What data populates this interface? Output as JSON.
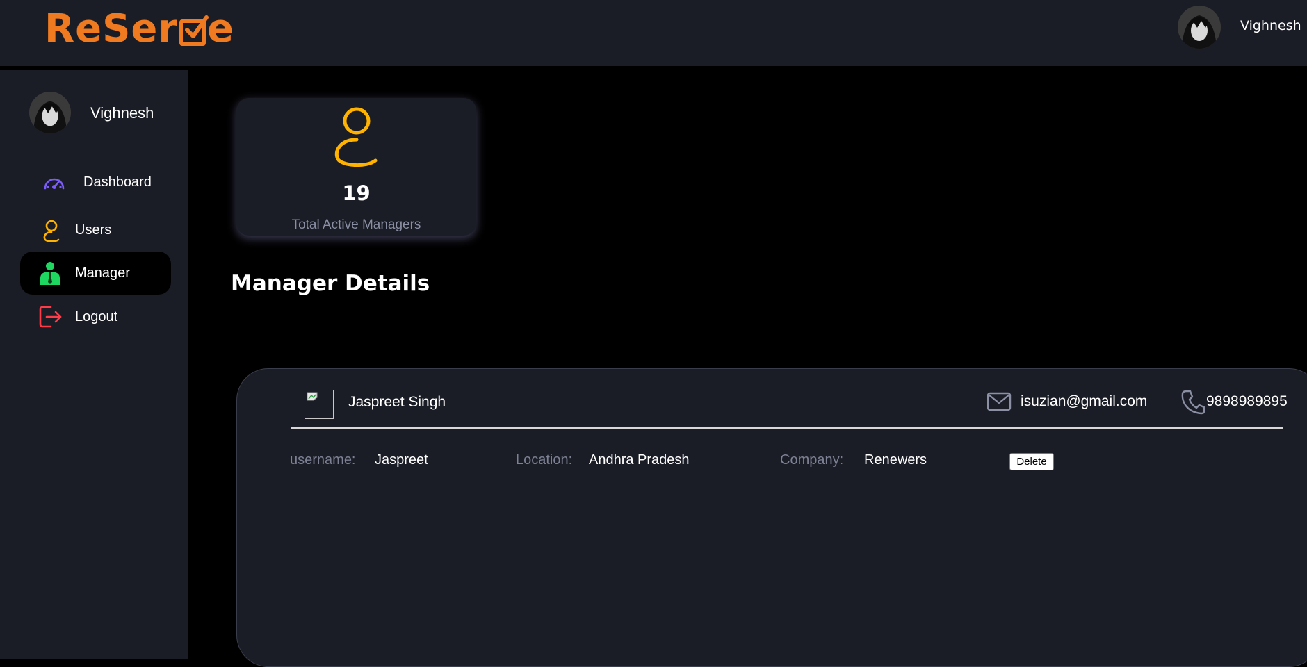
{
  "header": {
    "logo_text_1": "ReSer",
    "logo_text_2": "e",
    "user_name": "Vighnesh",
    "accent": "#f07a1f"
  },
  "sidebar": {
    "user_name": "Vighnesh",
    "items": [
      {
        "label": "Dashboard",
        "icon": "speedometer-icon",
        "color": "#7b5cff",
        "active": false
      },
      {
        "label": "Users",
        "icon": "user-icon",
        "color": "#ffb300",
        "active": false
      },
      {
        "label": "Manager",
        "icon": "manager-icon",
        "color": "#1ed760",
        "active": true
      },
      {
        "label": "Logout",
        "icon": "logout-icon",
        "color": "#ff3b47",
        "active": false
      }
    ]
  },
  "stat": {
    "value": "19",
    "label": "Total Active Managers",
    "icon": "user-icon",
    "icon_color": "#ffb300"
  },
  "section_title": "Manager Details",
  "manager": {
    "name": "Jaspreet Singh",
    "email": "isuzian@gmail.com",
    "phone": "9898989895",
    "username_label": "username:",
    "username": "Jaspreet",
    "location_label": "Location:",
    "location": "Andhra Pradesh",
    "company_label": "Company:",
    "company": "Renewers",
    "delete_label": "Delete"
  }
}
